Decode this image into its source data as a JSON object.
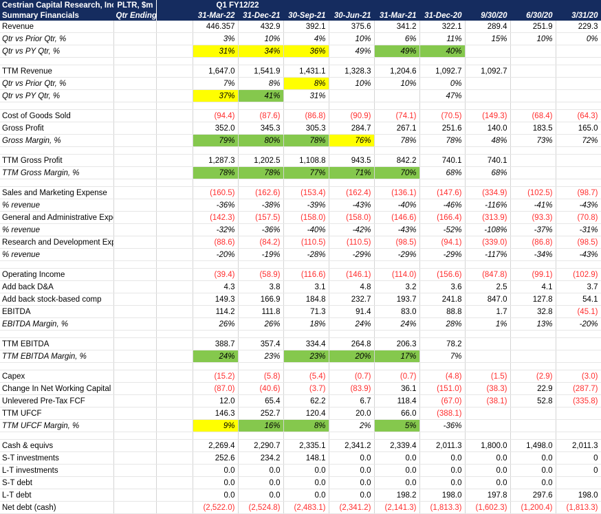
{
  "header": {
    "company_line1": "Cestrian Capital Research, Inc",
    "company_line2": "Summary Financials",
    "ticker_line1": "PLTR, $m",
    "ticker_line2": "Qtr Ending",
    "period_label": "Q1 FY12/22",
    "columns": [
      "31-Mar-22",
      "31-Dec-21",
      "30-Sep-21",
      "30-Jun-21",
      "31-Mar-21",
      "31-Dec-20",
      "9/30/20",
      "6/30/20",
      "3/31/20"
    ]
  },
  "colors": {
    "header_bg": "#152c5f",
    "header_text": "#ffffff",
    "negative_text": "#ff2d2d",
    "highlight_yellow": "#ffff00",
    "highlight_green": "#85c84d",
    "grid": "#d4d4d4"
  },
  "rows": [
    {
      "id": "revenue",
      "label": "Revenue",
      "style": "plain",
      "values": [
        "446.357",
        "432.9",
        "392.1",
        "375.6",
        "341.2",
        "322.1",
        "289.4",
        "251.9",
        "229.3"
      ],
      "fills": [
        "",
        "",
        "",
        "",
        "",
        "",
        "",
        "",
        ""
      ]
    },
    {
      "id": "rev-qoq",
      "label": "Qtr vs Prior Qtr, %",
      "style": "italic",
      "values": [
        "3%",
        "10%",
        "4%",
        "10%",
        "6%",
        "11%",
        "15%",
        "10%",
        "0%"
      ],
      "fills": [
        "",
        "",
        "",
        "",
        "",
        "",
        "",
        "",
        ""
      ]
    },
    {
      "id": "rev-pyq",
      "label": "Qtr vs PY Qtr, %",
      "style": "italic",
      "values": [
        "31%",
        "34%",
        "36%",
        "49%",
        "49%",
        "40%",
        "",
        "",
        ""
      ],
      "fills": [
        "yellow",
        "yellow",
        "yellow",
        "",
        "green",
        "green",
        "",
        "",
        ""
      ]
    },
    {
      "id": "sp1",
      "spacer": true
    },
    {
      "id": "ttm-revenue",
      "label": "TTM Revenue",
      "style": "plain",
      "values": [
        "1,647.0",
        "1,541.9",
        "1,431.1",
        "1,328.3",
        "1,204.6",
        "1,092.7",
        "1,092.7",
        "",
        ""
      ],
      "fills": [
        "",
        "",
        "",
        "",
        "",
        "",
        "",
        "",
        ""
      ]
    },
    {
      "id": "ttm-rev-qoq",
      "label": "Qtr vs Prior Qtr, %",
      "style": "italic",
      "values": [
        "7%",
        "8%",
        "8%",
        "10%",
        "10%",
        "0%",
        "",
        "",
        ""
      ],
      "fills": [
        "",
        "",
        "yellow",
        "",
        "",
        "",
        "",
        "",
        ""
      ]
    },
    {
      "id": "ttm-rev-pyq",
      "label": "Qtr vs PY Qtr, %",
      "style": "italic",
      "values": [
        "37%",
        "41%",
        "31%",
        "",
        "",
        "47%",
        "",
        "",
        ""
      ],
      "fills": [
        "yellow",
        "green",
        "",
        "",
        "",
        "",
        "",
        "",
        ""
      ]
    },
    {
      "id": "sp2",
      "spacer": true
    },
    {
      "id": "cogs",
      "label": "Cost of Goods Sold",
      "style": "negative",
      "values": [
        "(94.4)",
        "(87.6)",
        "(86.8)",
        "(90.9)",
        "(74.1)",
        "(70.5)",
        "(149.3)",
        "(68.4)",
        "(64.3)"
      ],
      "fills": [
        "",
        "",
        "",
        "",
        "",
        "",
        "",
        "",
        ""
      ]
    },
    {
      "id": "gross-profit",
      "label": "Gross Profit",
      "style": "plain",
      "values": [
        "352.0",
        "345.3",
        "305.3",
        "284.7",
        "267.1",
        "251.6",
        "140.0",
        "183.5",
        "165.0"
      ],
      "fills": [
        "",
        "",
        "",
        "",
        "",
        "",
        "",
        "",
        ""
      ]
    },
    {
      "id": "gross-margin",
      "label": "Gross Margin, %",
      "style": "italic",
      "values": [
        "79%",
        "80%",
        "78%",
        "76%",
        "78%",
        "78%",
        "48%",
        "73%",
        "72%"
      ],
      "fills": [
        "green",
        "green",
        "green",
        "yellow",
        "",
        "",
        "",
        "",
        ""
      ]
    },
    {
      "id": "sp3",
      "spacer": true
    },
    {
      "id": "ttm-gross-profit",
      "label": "TTM Gross Profit",
      "style": "plain",
      "values": [
        "1,287.3",
        "1,202.5",
        "1,108.8",
        "943.5",
        "842.2",
        "740.1",
        "740.1",
        "",
        ""
      ],
      "fills": [
        "",
        "",
        "",
        "",
        "",
        "",
        "",
        "",
        ""
      ]
    },
    {
      "id": "ttm-gross-margin",
      "label": "TTM Gross Margin, %",
      "style": "italic",
      "values": [
        "78%",
        "78%",
        "77%",
        "71%",
        "70%",
        "68%",
        "68%",
        "",
        ""
      ],
      "fills": [
        "green",
        "green",
        "green",
        "green",
        "green",
        "",
        "",
        "",
        ""
      ]
    },
    {
      "id": "sp4",
      "spacer": true
    },
    {
      "id": "sm-expense",
      "label": "Sales and Marketing Expense",
      "style": "negative",
      "values": [
        "(160.5)",
        "(162.6)",
        "(153.4)",
        "(162.4)",
        "(136.1)",
        "(147.6)",
        "(334.9)",
        "(102.5)",
        "(98.7)"
      ],
      "fills": [
        "",
        "",
        "",
        "",
        "",
        "",
        "",
        "",
        ""
      ]
    },
    {
      "id": "sm-pct",
      "label": "% revenue",
      "style": "italic",
      "values": [
        "-36%",
        "-38%",
        "-39%",
        "-43%",
        "-40%",
        "-46%",
        "-116%",
        "-41%",
        "-43%"
      ],
      "fills": [
        "",
        "",
        "",
        "",
        "",
        "",
        "",
        "",
        ""
      ]
    },
    {
      "id": "ga-expense",
      "label": "General and Administrative Expense",
      "style": "negative",
      "values": [
        "(142.3)",
        "(157.5)",
        "(158.0)",
        "(158.0)",
        "(146.6)",
        "(166.4)",
        "(313.9)",
        "(93.3)",
        "(70.8)"
      ],
      "fills": [
        "",
        "",
        "",
        "",
        "",
        "",
        "",
        "",
        ""
      ]
    },
    {
      "id": "ga-pct",
      "label": "% revenue",
      "style": "italic",
      "values": [
        "-32%",
        "-36%",
        "-40%",
        "-42%",
        "-43%",
        "-52%",
        "-108%",
        "-37%",
        "-31%"
      ],
      "fills": [
        "",
        "",
        "",
        "",
        "",
        "",
        "",
        "",
        ""
      ]
    },
    {
      "id": "rd-expense",
      "label": "Research and Development Expense",
      "style": "negative",
      "values": [
        "(88.6)",
        "(84.2)",
        "(110.5)",
        "(110.5)",
        "(98.5)",
        "(94.1)",
        "(339.0)",
        "(86.8)",
        "(98.5)"
      ],
      "fills": [
        "",
        "",
        "",
        "",
        "",
        "",
        "",
        "",
        ""
      ]
    },
    {
      "id": "rd-pct",
      "label": "% revenue",
      "style": "italic",
      "values": [
        "-20%",
        "-19%",
        "-28%",
        "-29%",
        "-29%",
        "-29%",
        "-117%",
        "-34%",
        "-43%"
      ],
      "fills": [
        "",
        "",
        "",
        "",
        "",
        "",
        "",
        "",
        ""
      ]
    },
    {
      "id": "sp5",
      "spacer": true
    },
    {
      "id": "operating-income",
      "label": "Operating Income",
      "style": "negative",
      "values": [
        "(39.4)",
        "(58.9)",
        "(116.6)",
        "(146.1)",
        "(114.0)",
        "(156.6)",
        "(847.8)",
        "(99.1)",
        "(102.9)"
      ],
      "fills": [
        "",
        "",
        "",
        "",
        "",
        "",
        "",
        "",
        ""
      ]
    },
    {
      "id": "add-back-da",
      "label": "Add back D&A",
      "style": "plain",
      "values": [
        "4.3",
        "3.8",
        "3.1",
        "4.8",
        "3.2",
        "3.6",
        "2.5",
        "4.1",
        "3.7"
      ],
      "fills": [
        "",
        "",
        "",
        "",
        "",
        "",
        "",
        "",
        ""
      ]
    },
    {
      "id": "add-back-sbc",
      "label": "Add back stock-based comp",
      "style": "plain",
      "values": [
        "149.3",
        "166.9",
        "184.8",
        "232.7",
        "193.7",
        "241.8",
        "847.0",
        "127.8",
        "54.1"
      ],
      "fills": [
        "",
        "",
        "",
        "",
        "",
        "",
        "",
        "",
        ""
      ]
    },
    {
      "id": "ebitda",
      "label": "EBITDA",
      "style": "mixed",
      "topline": true,
      "values": [
        "114.2",
        "111.8",
        "71.3",
        "91.4",
        "83.0",
        "88.8",
        "1.7",
        "32.8",
        "(45.1)"
      ],
      "negflags": [
        false,
        false,
        false,
        false,
        false,
        false,
        false,
        false,
        true
      ],
      "fills": [
        "",
        "",
        "",
        "",
        "",
        "",
        "",
        "",
        ""
      ]
    },
    {
      "id": "ebitda-margin",
      "label": "EBITDA Margin, %",
      "style": "italic",
      "values": [
        "26%",
        "26%",
        "18%",
        "24%",
        "24%",
        "28%",
        "1%",
        "13%",
        "-20%"
      ],
      "fills": [
        "",
        "",
        "",
        "",
        "",
        "",
        "",
        "",
        ""
      ]
    },
    {
      "id": "sp6",
      "spacer": true
    },
    {
      "id": "ttm-ebitda",
      "label": "TTM EBITDA",
      "style": "plain",
      "values": [
        "388.7",
        "357.4",
        "334.4",
        "264.8",
        "206.3",
        "78.2",
        "",
        "",
        ""
      ],
      "fills": [
        "",
        "",
        "",
        "",
        "",
        "",
        "",
        "",
        ""
      ]
    },
    {
      "id": "ttm-ebitda-margin",
      "label": "TTM EBITDA Margin, %",
      "style": "italic",
      "values": [
        "24%",
        "23%",
        "23%",
        "20%",
        "17%",
        "7%",
        "",
        "",
        ""
      ],
      "fills": [
        "green",
        "",
        "green",
        "green",
        "green",
        "",
        "",
        "",
        ""
      ]
    },
    {
      "id": "sp7",
      "spacer": true
    },
    {
      "id": "capex",
      "label": "Capex",
      "style": "negative",
      "values": [
        "(15.2)",
        "(5.8)",
        "(5.4)",
        "(0.7)",
        "(0.7)",
        "(4.8)",
        "(1.5)",
        "(2.9)",
        "(3.0)"
      ],
      "fills": [
        "",
        "",
        "",
        "",
        "",
        "",
        "",
        "",
        ""
      ]
    },
    {
      "id": "change-nwc",
      "label": "Change In Net Working Capital",
      "style": "mixed",
      "values": [
        "(87.0)",
        "(40.6)",
        "(3.7)",
        "(83.9)",
        "36.1",
        "(151.0)",
        "(38.3)",
        "22.9",
        "(287.7)"
      ],
      "negflags": [
        true,
        true,
        true,
        true,
        false,
        true,
        true,
        false,
        true
      ],
      "fills": [
        "",
        "",
        "",
        "",
        "",
        "",
        "",
        "",
        ""
      ]
    },
    {
      "id": "unlevered-fcf",
      "label": "Unlevered Pre-Tax FCF",
      "style": "mixed",
      "values": [
        "12.0",
        "65.4",
        "62.2",
        "6.7",
        "118.4",
        "(67.0)",
        "(38.1)",
        "52.8",
        "(335.8)"
      ],
      "negflags": [
        false,
        false,
        false,
        false,
        false,
        true,
        true,
        false,
        true
      ],
      "fills": [
        "",
        "",
        "",
        "",
        "",
        "",
        "",
        "",
        ""
      ]
    },
    {
      "id": "ttm-ufcf",
      "label": "TTM UFCF",
      "style": "mixed",
      "values": [
        "146.3",
        "252.7",
        "120.4",
        "20.0",
        "66.0",
        "(388.1)",
        "",
        "",
        ""
      ],
      "negflags": [
        false,
        false,
        false,
        false,
        false,
        true,
        false,
        false,
        false
      ],
      "fills": [
        "",
        "",
        "",
        "",
        "",
        "",
        "",
        "",
        ""
      ]
    },
    {
      "id": "ttm-ufcf-margin",
      "label": "TTM UFCF Margin, %",
      "style": "italic",
      "values": [
        "9%",
        "16%",
        "8%",
        "2%",
        "5%",
        "-36%",
        "",
        "",
        ""
      ],
      "fills": [
        "yellow",
        "green",
        "green",
        "",
        "green",
        "",
        "",
        "",
        ""
      ]
    },
    {
      "id": "sp8",
      "spacer": true
    },
    {
      "id": "cash-equivs",
      "label": "Cash & equivs",
      "style": "plain",
      "values": [
        "2,269.4",
        "2,290.7",
        "2,335.1",
        "2,341.2",
        "2,339.4",
        "2,011.3",
        "1,800.0",
        "1,498.0",
        "2,011.3"
      ],
      "fills": [
        "",
        "",
        "",
        "",
        "",
        "",
        "",
        "",
        ""
      ]
    },
    {
      "id": "st-investments",
      "label": "S-T investments",
      "style": "plain",
      "values": [
        "252.6",
        "234.2",
        "148.1",
        "0.0",
        "0.0",
        "0.0",
        "0.0",
        "0.0",
        "0"
      ],
      "fills": [
        "",
        "",
        "",
        "",
        "",
        "",
        "",
        "",
        ""
      ]
    },
    {
      "id": "lt-investments",
      "label": "L-T investments",
      "style": "plain",
      "values": [
        "0.0",
        "0.0",
        "0.0",
        "0.0",
        "0.0",
        "0.0",
        "0.0",
        "0.0",
        "0"
      ],
      "fills": [
        "",
        "",
        "",
        "",
        "",
        "",
        "",
        "",
        ""
      ]
    },
    {
      "id": "st-debt",
      "label": "S-T debt",
      "style": "plain",
      "values": [
        "0.0",
        "0.0",
        "0.0",
        "0.0",
        "0.0",
        "0.0",
        "0.0",
        "0.0",
        ""
      ],
      "fills": [
        "",
        "",
        "",
        "",
        "",
        "",
        "",
        "",
        ""
      ]
    },
    {
      "id": "lt-debt",
      "label": "L-T debt",
      "style": "plain",
      "values": [
        "0.0",
        "0.0",
        "0.0",
        "0.0",
        "198.2",
        "198.0",
        "197.8",
        "297.6",
        "198.0"
      ],
      "fills": [
        "",
        "",
        "",
        "",
        "",
        "",
        "",
        "",
        ""
      ]
    },
    {
      "id": "net-debt",
      "label": "Net debt (cash)",
      "style": "negative",
      "topline": true,
      "values": [
        "(2,522.0)",
        "(2,524.8)",
        "(2,483.1)",
        "(2,341.2)",
        "(2,141.3)",
        "(1,813.3)",
        "(1,602.3)",
        "(1,200.4)",
        "(1,813.3)"
      ],
      "fills": [
        "",
        "",
        "",
        "",
        "",
        "",
        "",
        "",
        ""
      ]
    }
  ]
}
